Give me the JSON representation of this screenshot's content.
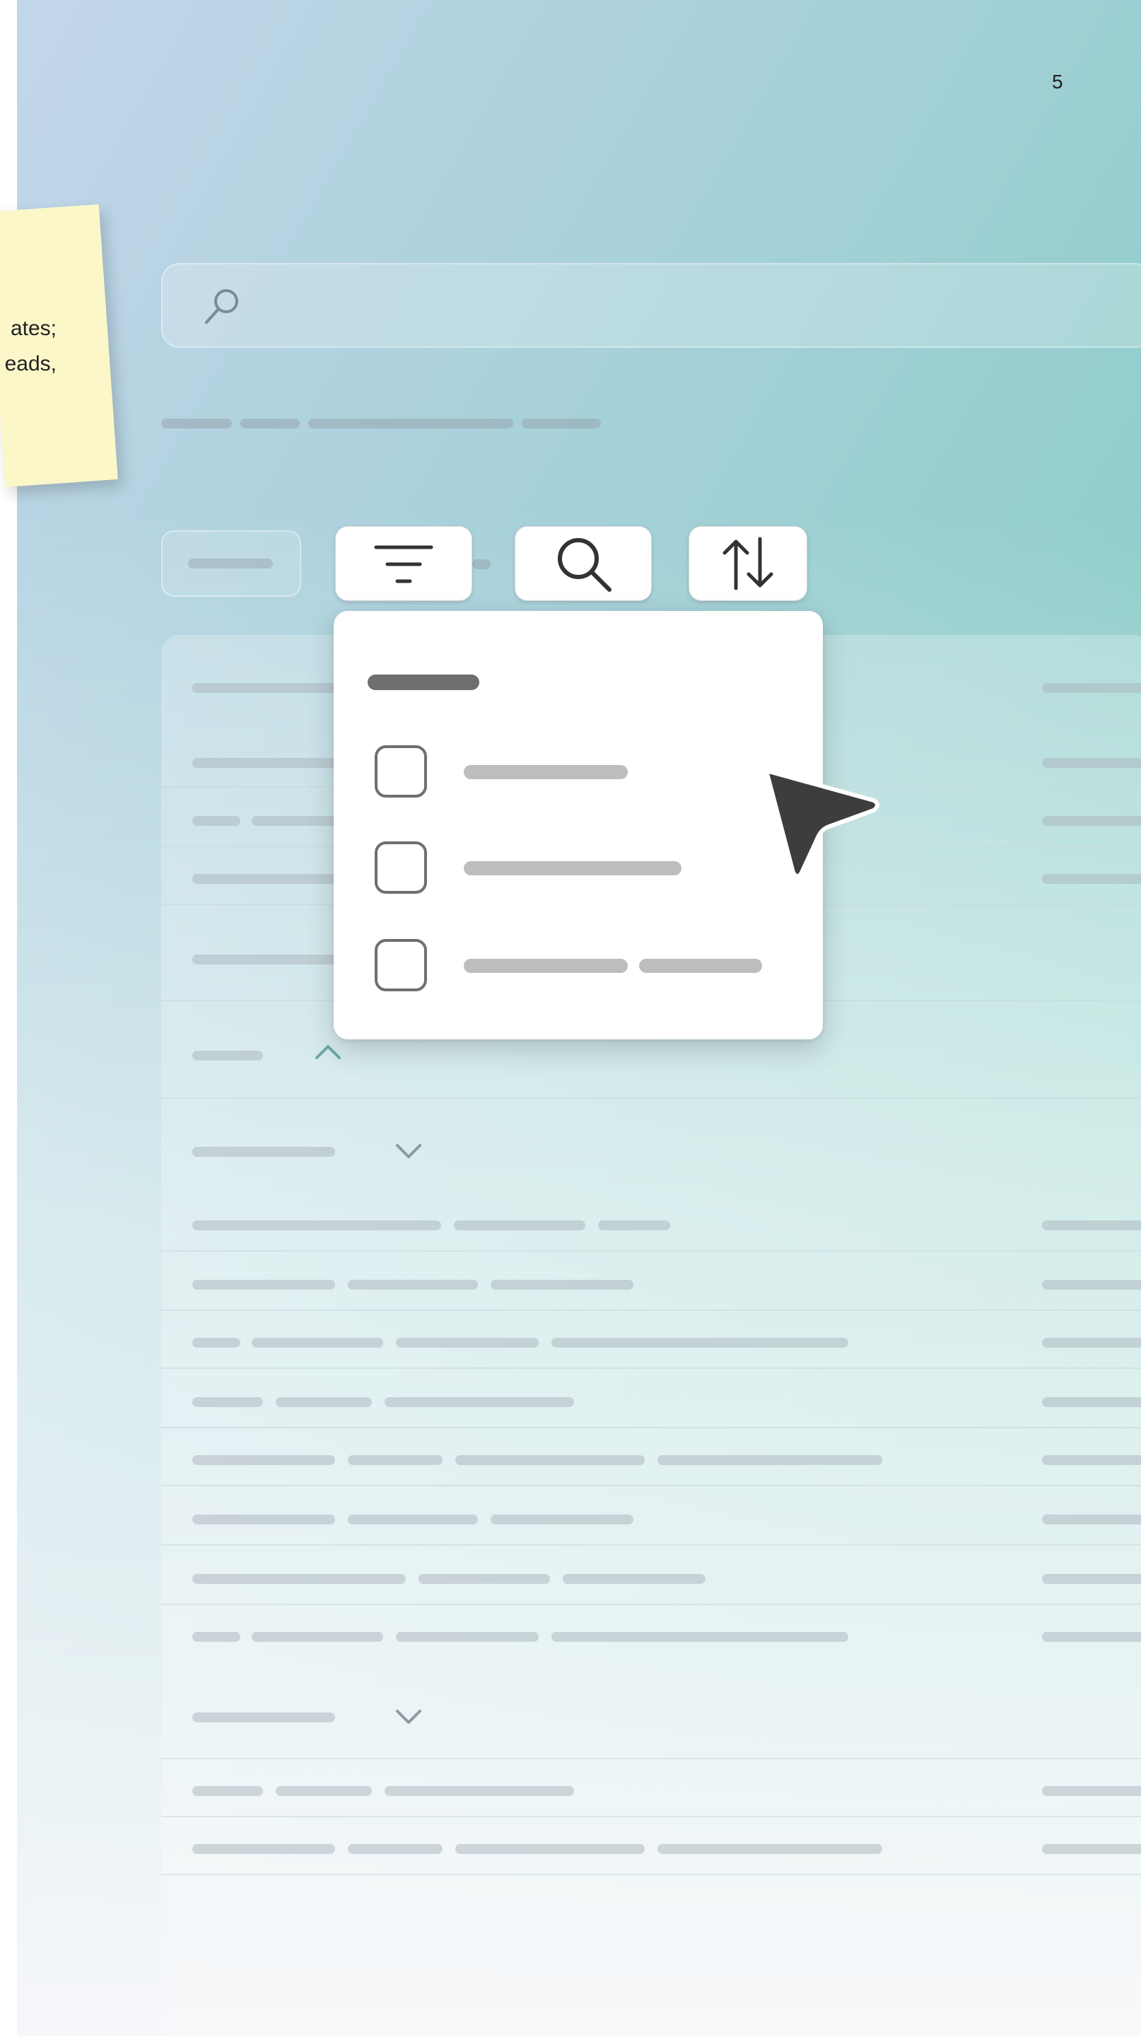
{
  "page": {
    "number": "5"
  },
  "sticky_note": {
    "line1": "ates;",
    "line2": "eads,"
  },
  "toolbar": {
    "filter_icon": "filter-icon",
    "search_icon": "search-icon",
    "sort_icon": "sort-arrows-icon"
  },
  "dropdown": {
    "options": [
      {
        "checked": false
      },
      {
        "checked": false
      },
      {
        "checked": false
      }
    ]
  },
  "colors": {
    "gradient_start": "#c3d6ea",
    "gradient_end": "#7fc8c0",
    "sticky": "#fbf7c9",
    "cursor": "#3d3d3d"
  }
}
